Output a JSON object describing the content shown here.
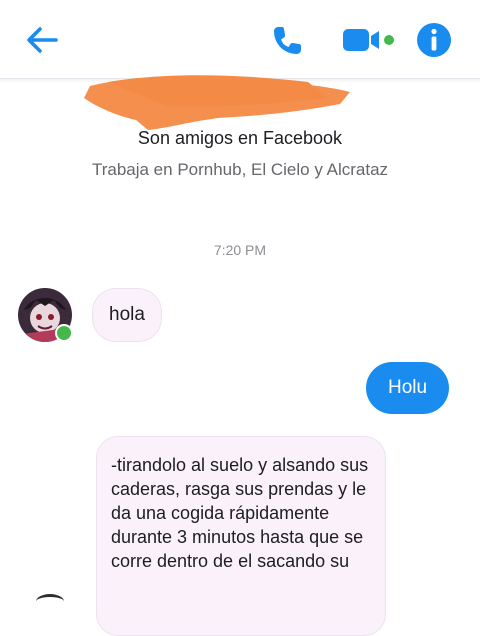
{
  "header": {
    "back_icon": "back-arrow-icon",
    "call_icon": "phone-icon",
    "video_icon": "video-camera-icon",
    "info_icon": "info-icon",
    "accent_color": "#1a8cf0",
    "status_color": "#44b84a"
  },
  "profile": {
    "friends_text": "Son amigos en Facebook",
    "work_text": "Trabaja en Pornhub, El Cielo y Alcrataz"
  },
  "conversation": {
    "timestamp": "7:20 PM",
    "messages": [
      {
        "sender": "other",
        "text": "hola"
      },
      {
        "sender": "me",
        "text": "Holu"
      },
      {
        "sender": "other",
        "text": "-tirandolo al suelo y alsando sus caderas, rasga sus prendas y le da una cogida rápidamente durante 3 minutos hasta que se corre dentro de el sacando su"
      }
    ]
  }
}
